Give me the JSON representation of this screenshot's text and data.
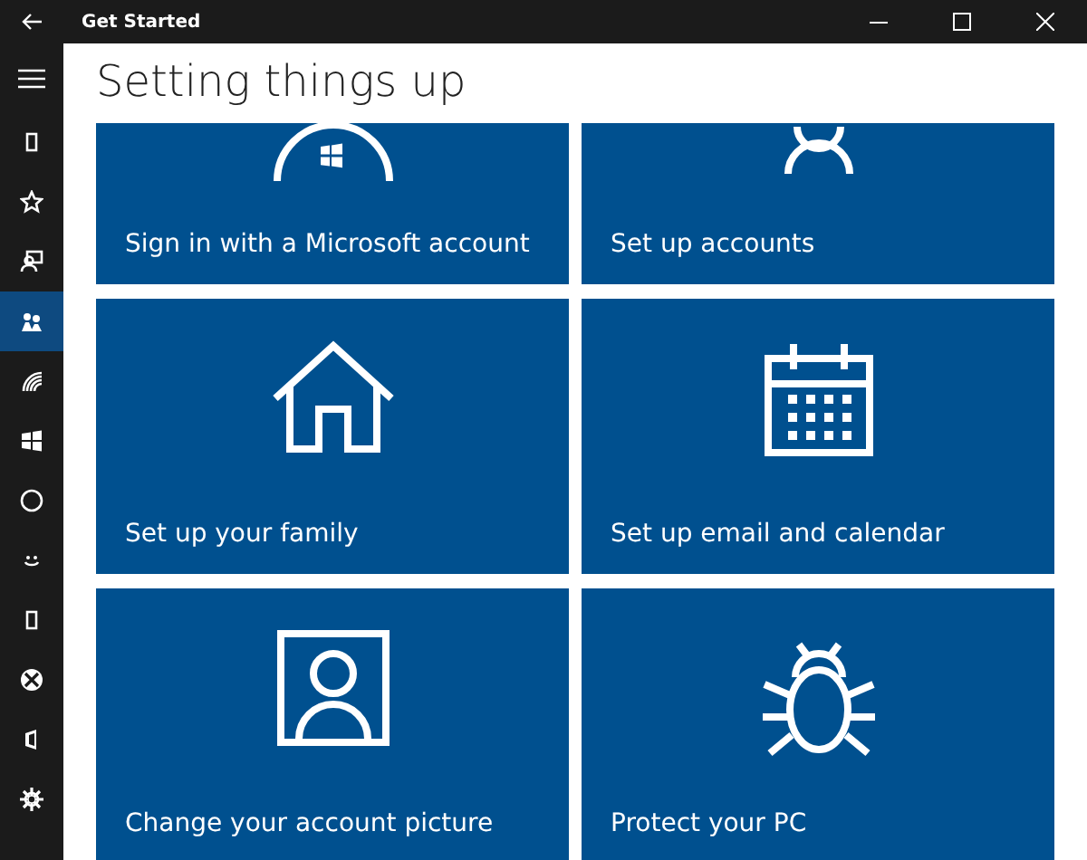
{
  "window": {
    "title": "Get Started"
  },
  "sidebar": {
    "items": [
      {
        "selected": false
      },
      {
        "selected": false
      },
      {
        "selected": false
      },
      {
        "selected": true
      },
      {
        "selected": false
      },
      {
        "selected": false
      },
      {
        "selected": false
      },
      {
        "selected": false
      },
      {
        "selected": false
      },
      {
        "selected": false
      },
      {
        "selected": false
      },
      {
        "selected": false
      }
    ]
  },
  "heading": "Setting things up",
  "tiles": [
    {
      "label": "Sign in with a Microsoft account"
    },
    {
      "label": "Set up accounts"
    },
    {
      "label": "Set up your family"
    },
    {
      "label": "Set up email and calendar"
    },
    {
      "label": "Change your account picture"
    },
    {
      "label": "Protect your PC"
    }
  ]
}
